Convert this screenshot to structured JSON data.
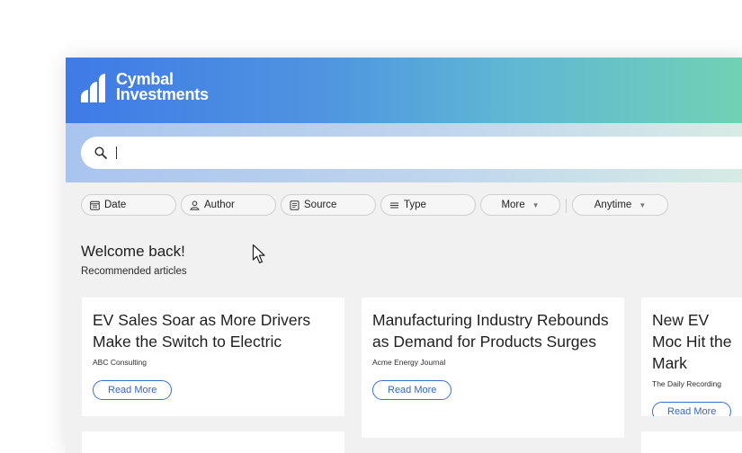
{
  "brand": {
    "name_line1": "Cymbal",
    "name_line2": "Investments"
  },
  "search": {
    "value": "",
    "placeholder": ""
  },
  "filters": [
    {
      "label": "Date",
      "icon": "calendar-icon"
    },
    {
      "label": "Author",
      "icon": "person-icon"
    },
    {
      "label": "Source",
      "icon": "document-icon"
    },
    {
      "label": "Type",
      "icon": "lines-icon"
    },
    {
      "label": "More",
      "icon": "chevron-down-icon"
    },
    {
      "label": "Anytime",
      "icon": "chevron-down-icon"
    }
  ],
  "greeting": {
    "title": "Welcome back!",
    "subtitle": "Recommended articles"
  },
  "articles": [
    {
      "title": "EV Sales Soar as More Drivers Make the Switch to Electric",
      "source": "ABC Consulting",
      "button": "Read More"
    },
    {
      "title": "Manufacturing Industry Rebounds as Demand for Products Surges",
      "source": "Acme Energy Journal",
      "button": "Read More"
    },
    {
      "title": "New EV Moc Hit the Mark",
      "source": "The Daily Recording",
      "button": "Read More"
    }
  ],
  "colors": {
    "accent": "#3564c9",
    "header_start": "#3f7ae6",
    "header_end": "#72d2b4"
  }
}
